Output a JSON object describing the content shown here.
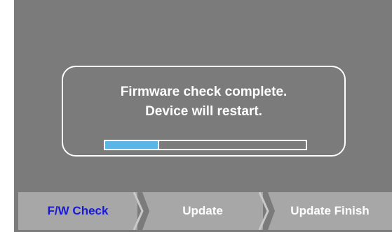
{
  "dialog": {
    "line1": "Firmware check complete.",
    "line2": "Device will restart.",
    "progress_fraction": 0.27
  },
  "steps": [
    {
      "label": "F/W Check",
      "active": true
    },
    {
      "label": "Update",
      "active": false
    },
    {
      "label": "Update Finish",
      "active": false
    }
  ],
  "colors": {
    "screen_bg": "#7b7b7b",
    "step_bg": "#a7a7a7",
    "active_step_text": "#1a1ad6",
    "progress_fill": "#5bb6e6"
  }
}
